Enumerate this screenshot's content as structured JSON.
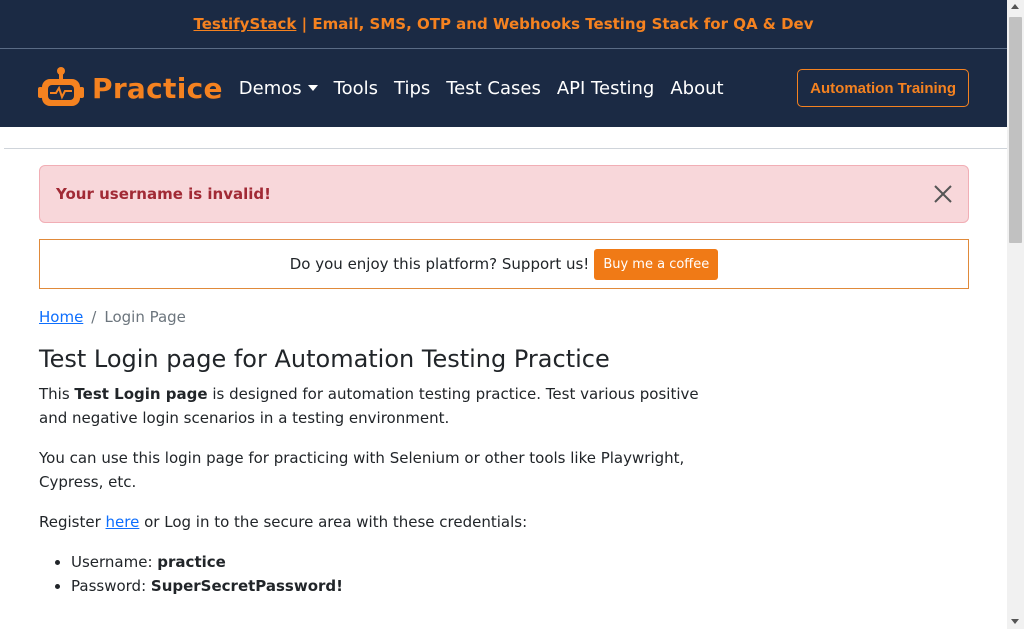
{
  "banner": {
    "link_text": "TestifyStack",
    "rest_text": " | Email, SMS, OTP and Webhooks Testing Stack for QA & Dev"
  },
  "navbar": {
    "brand": "Practice",
    "links": [
      "Demos",
      "Tools",
      "Tips",
      "Test Cases",
      "API Testing",
      "About"
    ],
    "cta": "Automation Training"
  },
  "alert": {
    "message": "Your username is invalid!"
  },
  "support": {
    "text": "Do you enjoy this platform? Support us!",
    "button": "Buy me a coffee"
  },
  "breadcrumb": {
    "home": "Home",
    "separator": "/",
    "current": "Login Page"
  },
  "content": {
    "title": "Test Login page for Automation Testing Practice",
    "p1_before": "This ",
    "p1_bold": "Test Login page",
    "p1_after": " is designed for automation testing practice. Test various positive and negative login scenarios in a testing environment.",
    "p2": "You can use this login page for practicing with Selenium or other tools like Playwright, Cypress, etc.",
    "p3_before": "Register ",
    "p3_link": "here",
    "p3_after": " or Log in to the secure area with these credentials:",
    "credentials": [
      {
        "label": "Username: ",
        "value": "practice"
      },
      {
        "label": "Password: ",
        "value": "SuperSecretPassword!"
      }
    ]
  },
  "colors": {
    "navy": "#1b2a44",
    "orange": "#f58220",
    "alert_bg": "#f8d7da",
    "alert_text": "#a12a35",
    "link": "#0d6efd"
  }
}
